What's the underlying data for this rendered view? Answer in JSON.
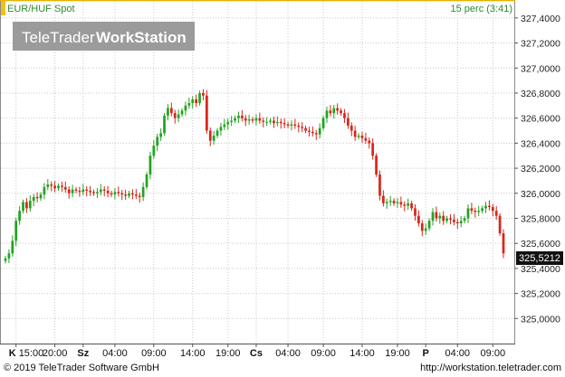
{
  "header": {
    "symbol": "EUR/HUF Spot",
    "refresh": "15 perc (3:41)",
    "watermark_brand": "TeleTrader",
    "watermark_product": "WorkStation"
  },
  "footer": {
    "copyright": "© 2019 TeleTrader Software GmbH",
    "url": "http://workstation.teletrader.com"
  },
  "colors": {
    "up": "#22a322",
    "down": "#d9251b",
    "grid": "#c8c8c8",
    "accent_line": "#e7b000"
  },
  "chart_data": {
    "type": "candlestick",
    "title": "EUR/HUF Spot",
    "grid": true,
    "ylim": [
      324.8,
      327.5
    ],
    "y_ticks": [
      325.0,
      325.2,
      325.4,
      325.6,
      325.8,
      326.0,
      326.2,
      326.4,
      326.6,
      326.8,
      327.0,
      327.2,
      327.4
    ],
    "y_tick_labels": [
      "325,0000",
      "325,2000",
      "325,4000",
      "325,6000",
      "325,8000",
      "326,0000",
      "326,2000",
      "326,4000",
      "326,6000",
      "326,8000",
      "327,0000",
      "327,2000",
      "327,4000"
    ],
    "last_value": 325.5212,
    "last_value_label": "325,5212",
    "x_tick_labels": [
      {
        "day": "K",
        "time": "15:00",
        "index": 3
      },
      {
        "day": "",
        "time": "20:00",
        "index": 14
      },
      {
        "day": "Sz",
        "time": "",
        "index": 22
      },
      {
        "day": "",
        "time": "04:00",
        "index": 31
      },
      {
        "day": "",
        "time": "09:00",
        "index": 42
      },
      {
        "day": "",
        "time": "14:00",
        "index": 53
      },
      {
        "day": "",
        "time": "19:00",
        "index": 63
      },
      {
        "day": "Cs",
        "time": "",
        "index": 71
      },
      {
        "day": "",
        "time": "04:00",
        "index": 80
      },
      {
        "day": "",
        "time": "09:00",
        "index": 90
      },
      {
        "day": "",
        "time": "14:00",
        "index": 101
      },
      {
        "day": "",
        "time": "19:00",
        "index": 111
      },
      {
        "day": "P",
        "time": "",
        "index": 119
      },
      {
        "day": "",
        "time": "04:00",
        "index": 128
      },
      {
        "day": "",
        "time": "09:00",
        "index": 138
      }
    ],
    "close": [
      325.48,
      325.52,
      325.62,
      325.78,
      325.86,
      325.93,
      325.88,
      325.94,
      325.97,
      325.96,
      325.99,
      326.05,
      326.07,
      326.06,
      326.04,
      326.06,
      326.05,
      326.03,
      326.0,
      326.03,
      326.02,
      326.01,
      326.03,
      326.02,
      326.01,
      326.0,
      326.01,
      326.03,
      326.02,
      326.0,
      325.99,
      326.01,
      326.0,
      325.99,
      325.98,
      326.0,
      325.99,
      325.98,
      325.97,
      326.05,
      326.15,
      326.3,
      326.38,
      326.45,
      326.48,
      326.62,
      326.68,
      326.64,
      326.6,
      326.63,
      326.66,
      326.7,
      326.72,
      326.75,
      326.72,
      326.8,
      326.78,
      326.5,
      326.42,
      326.46,
      326.5,
      326.53,
      326.55,
      326.57,
      326.58,
      326.6,
      326.62,
      326.6,
      326.58,
      326.59,
      326.58,
      326.6,
      326.58,
      326.57,
      326.57,
      326.58,
      326.56,
      326.57,
      326.56,
      326.55,
      326.54,
      326.55,
      326.54,
      326.53,
      326.52,
      326.5,
      326.49,
      326.48,
      326.47,
      326.52,
      326.6,
      326.66,
      326.64,
      326.68,
      326.66,
      326.64,
      326.6,
      326.54,
      326.5,
      326.45,
      326.46,
      326.44,
      326.42,
      326.4,
      326.3,
      326.15,
      325.98,
      325.92,
      325.93,
      325.94,
      325.92,
      325.93,
      325.91,
      325.9,
      325.92,
      325.88,
      325.82,
      325.76,
      325.7,
      325.72,
      325.78,
      325.85,
      325.8,
      325.82,
      325.78,
      325.8,
      325.79,
      325.77,
      325.76,
      325.78,
      325.8,
      325.88,
      325.86,
      325.85,
      325.86,
      325.88,
      325.9,
      325.89,
      325.86,
      325.82,
      325.68,
      325.52
    ]
  }
}
